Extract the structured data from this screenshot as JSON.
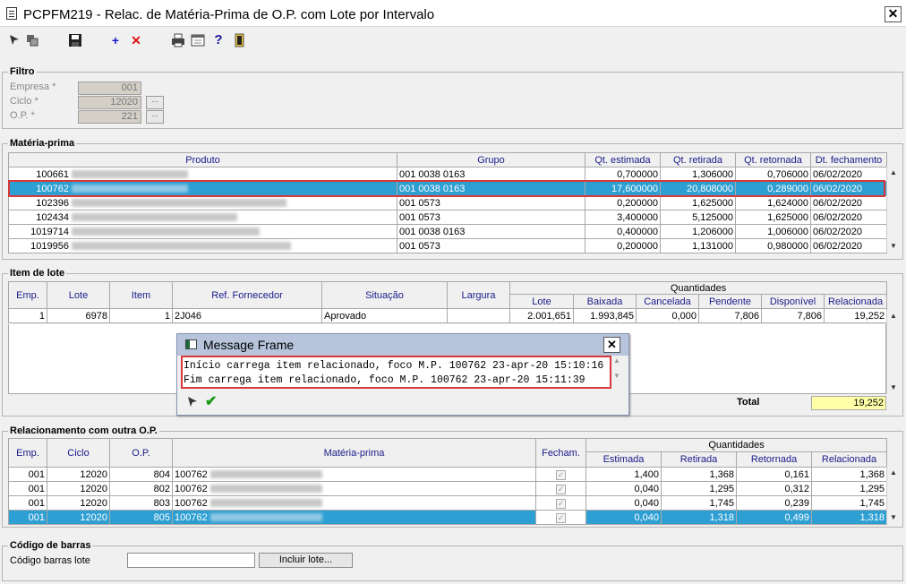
{
  "window": {
    "title": "PCPFM219 - Relac. de Matéria-Prima de O.P. com Lote por Intervalo",
    "close": "✕"
  },
  "toolbar": {
    "icons": [
      "cursor-icon",
      "copy-icon",
      "save-icon",
      "add-icon",
      "delete-icon",
      "print-icon",
      "calendar-icon",
      "help-icon",
      "exit-icon"
    ]
  },
  "filtro": {
    "title": "Filtro",
    "empresa_label": "Empresa *",
    "empresa_value": "001",
    "ciclo_label": "Ciclo *",
    "ciclo_value": "12020",
    "op_label": "O.P. *",
    "op_value": "221",
    "lookup": "⋯"
  },
  "materia": {
    "title": "Matéria-prima",
    "headers": [
      "Produto",
      "Grupo",
      "Qt. estimada",
      "Qt. retirada",
      "Qt. retornada",
      "Dt. fechamento"
    ],
    "rows": [
      {
        "code": "100661",
        "grupo": "001 0038 0163",
        "est": "0,700000",
        "ret": "1,306000",
        "retorn": "0,706000",
        "dt": "06/02/2020"
      },
      {
        "code": "100762",
        "grupo": "001 0038 0163",
        "est": "17,600000",
        "ret": "20,808000",
        "retorn": "0,289000",
        "dt": "06/02/2020"
      },
      {
        "code": "102396",
        "grupo": "001 0573",
        "est": "0,200000",
        "ret": "1,625000",
        "retorn": "1,624000",
        "dt": "06/02/2020"
      },
      {
        "code": "102434",
        "grupo": "001 0573",
        "est": "3,400000",
        "ret": "5,125000",
        "retorn": "1,625000",
        "dt": "06/02/2020"
      },
      {
        "code": "1019714",
        "grupo": "001 0038 0163",
        "est": "0,400000",
        "ret": "1,206000",
        "retorn": "1,006000",
        "dt": "06/02/2020"
      },
      {
        "code": "1019956",
        "grupo": "001 0573",
        "est": "0,200000",
        "ret": "1,131000",
        "retorn": "0,980000",
        "dt": "06/02/2020"
      }
    ]
  },
  "lote": {
    "title": "Item de lote",
    "headers": {
      "emp": "Emp.",
      "lote": "Lote",
      "item": "Item",
      "ref": "Ref. Fornecedor",
      "sit": "Situação",
      "larg": "Largura",
      "quant": "Quantidades",
      "q_lote": "Lote",
      "q_baixada": "Baixada",
      "q_cancelada": "Cancelada",
      "q_pendente": "Pendente",
      "q_disponivel": "Disponível",
      "q_relacionada": "Relacionada"
    },
    "row": {
      "emp": "1",
      "lote": "6978",
      "item": "1",
      "ref": "2J046",
      "sit": "Aprovado",
      "larg": "",
      "q_lote": "2.001,651",
      "q_baixada": "1.993,845",
      "q_cancelada": "0,000",
      "q_pendente": "7,806",
      "q_disponivel": "7,806",
      "q_relacionada": "19,252"
    },
    "total_label": "Total",
    "total_value": "19,252"
  },
  "message": {
    "title": "Message Frame",
    "line1": "Início carrega item relacionado, foco M.P. 100762 23-apr-20 15:10:16",
    "line2": "Fim carrega item relacionado, foco M.P. 100762 23-apr-20 15:11:39",
    "close": "✕"
  },
  "rel": {
    "title": "Relacionamento com outra O.P.",
    "headers": {
      "emp": "Emp.",
      "ciclo": "Ciclo",
      "op": "O.P.",
      "mp": "Matéria-prima",
      "fech": "Fecham.",
      "quant": "Quantidades",
      "est": "Estimada",
      "ret": "Retirada",
      "retorn": "Retornada",
      "relac": "Relacionada"
    },
    "rows": [
      {
        "emp": "001",
        "ciclo": "12020",
        "op": "804",
        "mp": "100762",
        "est": "1,400",
        "ret": "1,368",
        "retorn": "0,161",
        "relac": "1,368"
      },
      {
        "emp": "001",
        "ciclo": "12020",
        "op": "802",
        "mp": "100762",
        "est": "0,040",
        "ret": "1,295",
        "retorn": "0,312",
        "relac": "1,295"
      },
      {
        "emp": "001",
        "ciclo": "12020",
        "op": "803",
        "mp": "100762",
        "est": "0,040",
        "ret": "1,745",
        "retorn": "0,239",
        "relac": "1,745"
      },
      {
        "emp": "001",
        "ciclo": "12020",
        "op": "805",
        "mp": "100762",
        "est": "0,040",
        "ret": "1,318",
        "retorn": "0,499",
        "relac": "1,318"
      }
    ]
  },
  "barcode": {
    "title": "Código de barras",
    "label": "Código barras lote",
    "value": "",
    "button": "Incluir lote..."
  }
}
